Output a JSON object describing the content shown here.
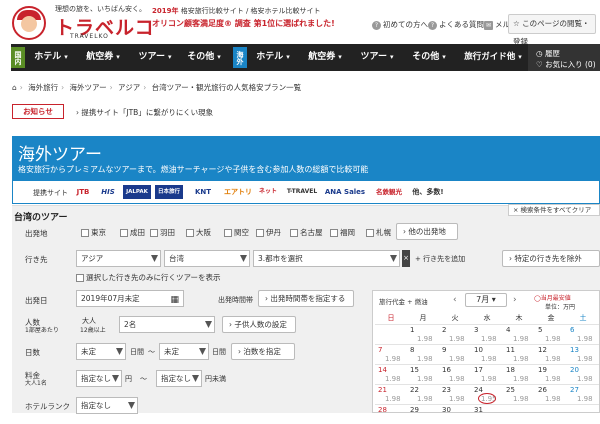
{
  "header": {
    "tagline": "理想の旅を、いちばん安く。",
    "brand": "トラベルコ",
    "brand_en": "TRAVELKO",
    "award_year": "2019年",
    "award_line1": "格安旅行比較サイト / 格安ホテル比較サイト",
    "award_line2": "オリコン顧客満足度® 調査 第1位に選ばれました!",
    "links": [
      "初めての方へ",
      "よくある質問",
      "メルマガ"
    ],
    "bookmark": "このページの閲覧・登録"
  },
  "nav": {
    "domestic_tag": "国内",
    "overseas_tag": "海外",
    "domestic_items": [
      "ホテル",
      "航空券",
      "ツアー",
      "その他"
    ],
    "overseas_items": [
      "ホテル",
      "航空券",
      "ツアー",
      "その他"
    ],
    "guide": "旅行ガイド他",
    "history": "履歴",
    "favorites": "お気に入り (0)"
  },
  "breadcrumb": [
    "海外旅行",
    "海外ツアー",
    "アジア",
    "台湾ツアー・観光旅行の人気格安プラン一覧"
  ],
  "notice": {
    "label": "お知らせ",
    "text": "提携サイト「JTB」に繋がりにくい現象"
  },
  "banner": {
    "title": "海外ツアー",
    "subtitle": "格安旅行からプレミアムなツアーまで。燃油サーチャージや子供を含む参加人数の総額で比較可能",
    "partners_label": "提携サイト",
    "partners": [
      "JTB",
      "HIS",
      "JALPAK",
      "日本旅行",
      "KNT",
      "エアトリ",
      "ネット",
      "T-TRAVEL",
      "ANA Sales",
      "名鉄観光",
      "他、多数!"
    ]
  },
  "search": {
    "title": "台湾のツアー",
    "save_button": "検索条件をすべてクリア",
    "departure_label": "出発地",
    "airports": [
      "東京",
      "成田",
      "羽田",
      "大阪",
      "関空",
      "伊丹",
      "名古屋",
      "福岡",
      "札幌"
    ],
    "other_departure": "他の出発地",
    "destination_label": "行き先",
    "dest_region": "アジア",
    "dest_country": "台湾",
    "dest_city": "3.都市を選択",
    "add_dest": "行き先を追加",
    "exclude_dest": "特定の行き先を除外",
    "visit_all": "選択した行き先のみに行くツアーを表示",
    "date_label": "出発日",
    "date_value": "2019年07月未定",
    "time_label": "出発時間帯",
    "time_button": "出発時間帯を指定する",
    "people_label": "人数",
    "people_sub": "1部屋あたり",
    "adult_label": "大人",
    "adult_sub": "12歳以上",
    "adult_value": "2名",
    "child_button": "子供人数の設定",
    "days_label": "日数",
    "days_from": "未定",
    "days_mid": "日間",
    "days_tilde": "〜",
    "days_to": "未定",
    "days_end": "日間",
    "nights_button": "泊数を指定",
    "price_label": "料金",
    "price_sub": "大人1名",
    "price_from": "指定なし",
    "yen": "円",
    "tilde": "〜",
    "price_to": "指定なし",
    "price_end": "円未満",
    "hotel_label": "ホテルランク",
    "hotel_value": "指定なし"
  },
  "calendar": {
    "header": "旅行代金 + 燃油",
    "month": "7月",
    "legend": "当月最安値",
    "unit": "単位：万円",
    "dow": [
      "日",
      "月",
      "火",
      "水",
      "木",
      "金",
      "土"
    ],
    "rows": [
      [
        {
          "d": "",
          "p": ""
        },
        {
          "d": "1",
          "p": "1.98"
        },
        {
          "d": "2",
          "p": "1.98"
        },
        {
          "d": "3",
          "p": "1.98"
        },
        {
          "d": "4",
          "p": "1.98"
        },
        {
          "d": "5",
          "p": "1.98"
        },
        {
          "d": "6",
          "p": "1.98"
        }
      ],
      [
        {
          "d": "7",
          "p": "1.98"
        },
        {
          "d": "8",
          "p": "1.98"
        },
        {
          "d": "9",
          "p": "1.98"
        },
        {
          "d": "10",
          "p": "1.98"
        },
        {
          "d": "11",
          "p": "1.98"
        },
        {
          "d": "12",
          "p": "1.98"
        },
        {
          "d": "13",
          "p": "1.98"
        }
      ],
      [
        {
          "d": "14",
          "p": "1.98"
        },
        {
          "d": "15",
          "p": "1.98"
        },
        {
          "d": "16",
          "p": "1.98"
        },
        {
          "d": "17",
          "p": "1.98"
        },
        {
          "d": "18",
          "p": "1.98"
        },
        {
          "d": "19",
          "p": "1.98"
        },
        {
          "d": "20",
          "p": "1.98"
        }
      ],
      [
        {
          "d": "21",
          "p": "1.98"
        },
        {
          "d": "22",
          "p": "1.98"
        },
        {
          "d": "23",
          "p": "1.98"
        },
        {
          "d": "24",
          "p": "1.95"
        },
        {
          "d": "25",
          "p": "1.98"
        },
        {
          "d": "26",
          "p": "1.98"
        },
        {
          "d": "27",
          "p": "1.98"
        }
      ],
      [
        {
          "d": "28",
          "p": ""
        },
        {
          "d": "29",
          "p": ""
        },
        {
          "d": "30",
          "p": ""
        },
        {
          "d": "31",
          "p": ""
        },
        {
          "d": "",
          "p": ""
        },
        {
          "d": "",
          "p": ""
        },
        {
          "d": "",
          "p": ""
        }
      ]
    ],
    "lowest_day": "24"
  },
  "colors": {
    "brand_red": "#c8232c",
    "domestic_green": "#5a8d25",
    "overseas_blue": "#1a85c6",
    "nav_dark": "#222222"
  }
}
